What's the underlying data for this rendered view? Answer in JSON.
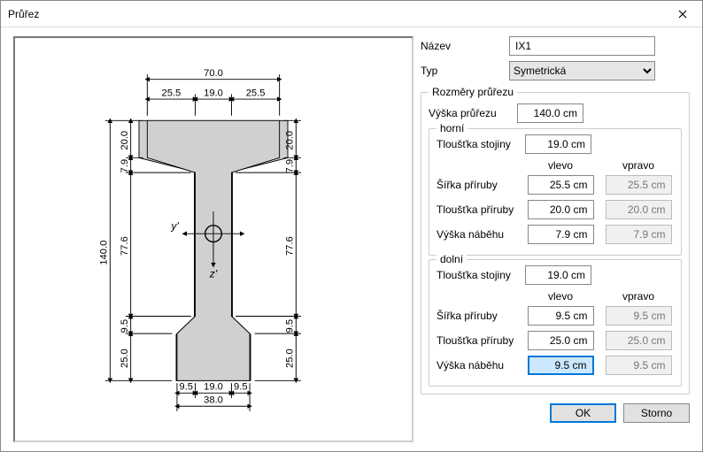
{
  "window": {
    "title": "Průřez"
  },
  "name": {
    "label": "Název",
    "value": "IX1"
  },
  "type": {
    "label": "Typ",
    "value": "Symetrická",
    "options": [
      "Symetrická"
    ]
  },
  "groups": {
    "dims": {
      "legend": "Rozměry průřezu",
      "height": {
        "label": "Výška průřezu",
        "value": "140.0 cm"
      }
    },
    "top": {
      "legend": "horní",
      "web_thickness": {
        "label": "Tloušťka stojiny",
        "value": "19.0 cm"
      },
      "col_left": "vlevo",
      "col_right": "vpravo",
      "flange_width": {
        "label": "Šířka příruby",
        "left": "25.5 cm",
        "right": "25.5 cm"
      },
      "flange_thickness": {
        "label": "Tloušťka příruby",
        "left": "20.0 cm",
        "right": "20.0 cm"
      },
      "haunch_height": {
        "label": "Výška náběhu",
        "left": "7.9 cm",
        "right": "7.9 cm"
      }
    },
    "bottom": {
      "legend": "dolní",
      "web_thickness": {
        "label": "Tloušťka stojiny",
        "value": "19.0 cm"
      },
      "col_left": "vlevo",
      "col_right": "vpravo",
      "flange_width": {
        "label": "Šířka příruby",
        "left": "9.5 cm",
        "right": "9.5 cm"
      },
      "flange_thickness": {
        "label": "Tloušťka příruby",
        "left": "25.0 cm",
        "right": "25.0 cm"
      },
      "haunch_height": {
        "label": "Výška náběhu",
        "left": "9.5 cm",
        "right": "9.5 cm"
      }
    }
  },
  "buttons": {
    "ok": "OK",
    "cancel": "Storno"
  },
  "diagram": {
    "labels": {
      "top_total": "70.0",
      "top_left": "25.5",
      "top_mid": "19.0",
      "top_right": "25.5",
      "left_total": "140.0",
      "seg_20": "20.0",
      "seg_79": "7.9",
      "seg_776": "77.6",
      "seg_95": "9.5",
      "seg_25": "25.0",
      "bot_left": "9.5",
      "bot_mid": "19.0",
      "bot_right": "9.5",
      "bot_total": "38.0",
      "y_axis": "y'",
      "z_axis": "z'"
    }
  }
}
